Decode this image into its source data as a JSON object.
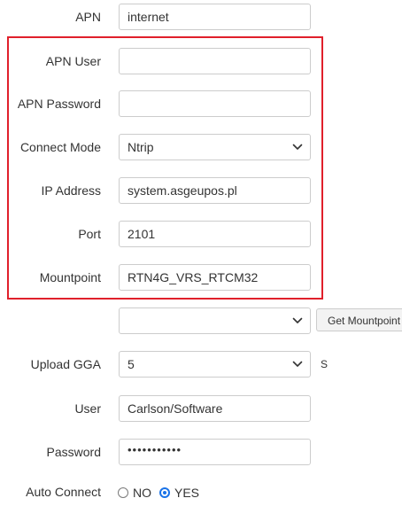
{
  "form": {
    "apn": {
      "label": "APN",
      "value": "internet"
    },
    "apn_user": {
      "label": "APN User",
      "value": ""
    },
    "apn_password": {
      "label": "APN Password",
      "value": ""
    },
    "connect_mode": {
      "label": "Connect Mode",
      "value": "Ntrip"
    },
    "ip_address": {
      "label": "IP Address",
      "value": "system.asgeupos.pl"
    },
    "port": {
      "label": "Port",
      "value": "2101"
    },
    "mountpoint": {
      "label": "Mountpoint",
      "value": "RTN4G_VRS_RTCM32"
    },
    "mountpoint_select": {
      "value": "",
      "button_label": "Get Mountpoint"
    },
    "upload_gga": {
      "label": "Upload GGA",
      "value": "5",
      "unit": "S"
    },
    "user": {
      "label": "User",
      "value": "Carlson/Software"
    },
    "password": {
      "label": "Password",
      "value": "•••••••••••"
    },
    "auto_connect": {
      "label": "Auto Connect",
      "options": [
        "NO",
        "YES"
      ],
      "selected": "YES"
    }
  },
  "colors": {
    "highlight_border": "#e0202b",
    "radio_selected": "#1a73e8",
    "input_border": "#cccccc"
  },
  "icons": {
    "dropdown": "chevron-down-icon"
  }
}
